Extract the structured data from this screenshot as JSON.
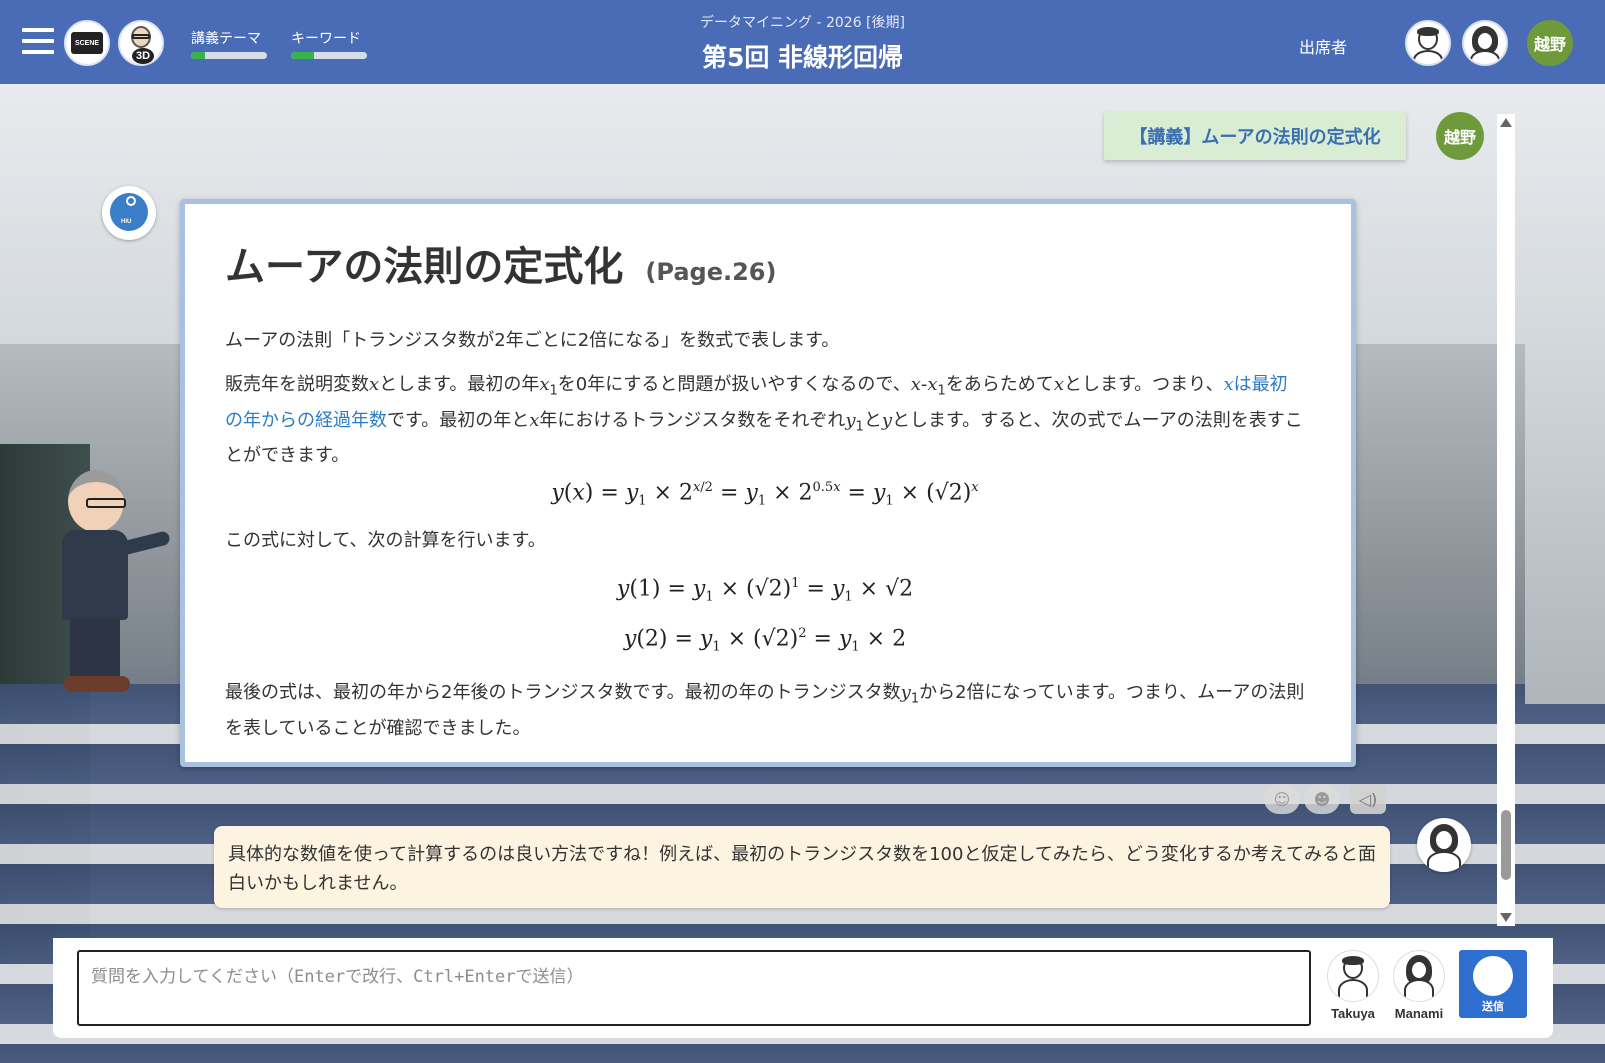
{
  "header": {
    "course": "データマイニング - 2026 [後期]",
    "title": "第5回 非線形回帰",
    "scene_label": "SCENE",
    "mode_label": "3D",
    "progress": [
      {
        "label": "講義テーマ",
        "value": 0.18
      },
      {
        "label": "キーワード",
        "value": 0.3
      }
    ],
    "attendees_label": "出席者",
    "teacher_name": "越野"
  },
  "lecture": {
    "tag": "【講義】ムーアの法則の定式化",
    "teacher_badge": "越野",
    "logo_text": "HIU"
  },
  "slide": {
    "title": "ムーアの法則の定式化",
    "page": "(Page.26)",
    "p1": "ムーアの法則「トランジスタ数が2年ごとに2倍になる」を数式で表します。",
    "p2_a": "販売年を説明変数",
    "p2_b": "とします。最初の年",
    "p2_c": "を0年にすると問題が扱いやすくなるので、",
    "p2_d": "をあらためて",
    "p2_e": "とします。つまり、",
    "p2_hl": "は最初の年からの経過年数",
    "p2_f": "です。最初の年と",
    "p2_g": "年におけるトランジスタ数をそれぞれ",
    "p2_h": "と",
    "p2_i": "とします。すると、次の式でムーアの法則を表すことができます。",
    "p3": "この式に対して、次の計算を行います。",
    "p4_a": "最後の式は、最初の年から2年後のトランジスタ数です。最初の年のトランジスタ数",
    "p4_b": "から2倍になっています。つまり、ムーアの法則を表していることが確認できました。"
  },
  "chat": {
    "message": "具体的な数値を使って計算するのは良い方法ですね！例えば、最初のトランジスタ数を100と仮定してみたら、どう変化するか考えてみると面白いかもしれません。"
  },
  "input": {
    "placeholder": "質問を入力してください（Enterで改行、Ctrl+Enterで送信）"
  },
  "students": [
    {
      "name": "Takuya"
    },
    {
      "name": "Manami"
    }
  ],
  "send_label": "送信",
  "colors": {
    "header_bg": "#4a6bb5",
    "accent_green": "#6f9a3c",
    "highlight_blue": "#2a7cc7",
    "send_blue": "#2f6fd0"
  }
}
